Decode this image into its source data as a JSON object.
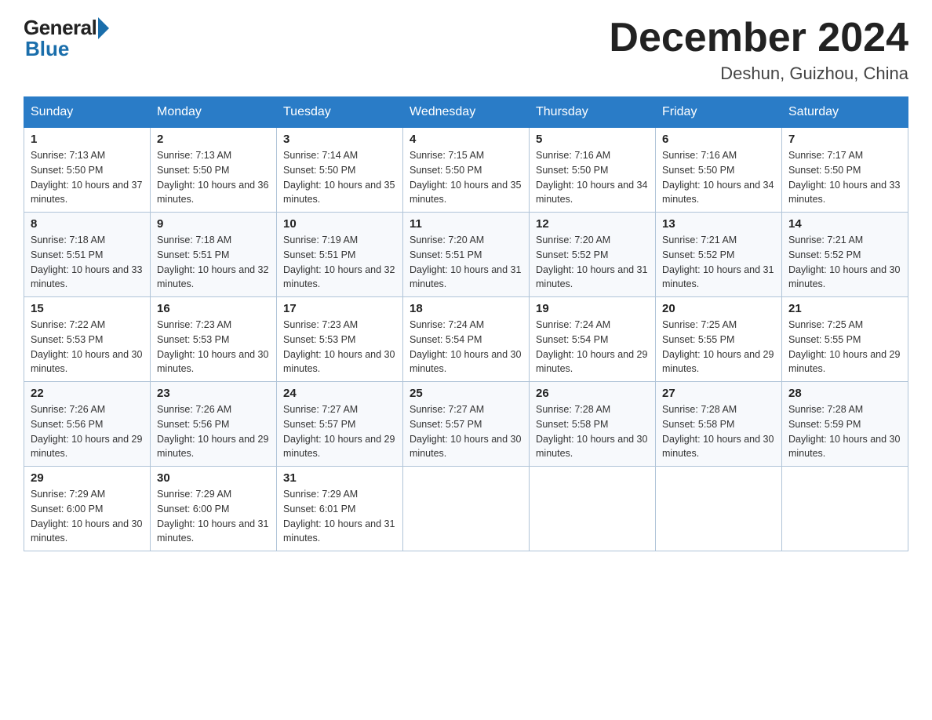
{
  "header": {
    "logo_text": "General",
    "logo_blue": "Blue",
    "month_title": "December 2024",
    "subtitle": "Deshun, Guizhou, China"
  },
  "days_of_week": [
    "Sunday",
    "Monday",
    "Tuesday",
    "Wednesday",
    "Thursday",
    "Friday",
    "Saturday"
  ],
  "weeks": [
    [
      {
        "day": "1",
        "sunrise": "7:13 AM",
        "sunset": "5:50 PM",
        "daylight": "10 hours and 37 minutes."
      },
      {
        "day": "2",
        "sunrise": "7:13 AM",
        "sunset": "5:50 PM",
        "daylight": "10 hours and 36 minutes."
      },
      {
        "day": "3",
        "sunrise": "7:14 AM",
        "sunset": "5:50 PM",
        "daylight": "10 hours and 35 minutes."
      },
      {
        "day": "4",
        "sunrise": "7:15 AM",
        "sunset": "5:50 PM",
        "daylight": "10 hours and 35 minutes."
      },
      {
        "day": "5",
        "sunrise": "7:16 AM",
        "sunset": "5:50 PM",
        "daylight": "10 hours and 34 minutes."
      },
      {
        "day": "6",
        "sunrise": "7:16 AM",
        "sunset": "5:50 PM",
        "daylight": "10 hours and 34 minutes."
      },
      {
        "day": "7",
        "sunrise": "7:17 AM",
        "sunset": "5:50 PM",
        "daylight": "10 hours and 33 minutes."
      }
    ],
    [
      {
        "day": "8",
        "sunrise": "7:18 AM",
        "sunset": "5:51 PM",
        "daylight": "10 hours and 33 minutes."
      },
      {
        "day": "9",
        "sunrise": "7:18 AM",
        "sunset": "5:51 PM",
        "daylight": "10 hours and 32 minutes."
      },
      {
        "day": "10",
        "sunrise": "7:19 AM",
        "sunset": "5:51 PM",
        "daylight": "10 hours and 32 minutes."
      },
      {
        "day": "11",
        "sunrise": "7:20 AM",
        "sunset": "5:51 PM",
        "daylight": "10 hours and 31 minutes."
      },
      {
        "day": "12",
        "sunrise": "7:20 AM",
        "sunset": "5:52 PM",
        "daylight": "10 hours and 31 minutes."
      },
      {
        "day": "13",
        "sunrise": "7:21 AM",
        "sunset": "5:52 PM",
        "daylight": "10 hours and 31 minutes."
      },
      {
        "day": "14",
        "sunrise": "7:21 AM",
        "sunset": "5:52 PM",
        "daylight": "10 hours and 30 minutes."
      }
    ],
    [
      {
        "day": "15",
        "sunrise": "7:22 AM",
        "sunset": "5:53 PM",
        "daylight": "10 hours and 30 minutes."
      },
      {
        "day": "16",
        "sunrise": "7:23 AM",
        "sunset": "5:53 PM",
        "daylight": "10 hours and 30 minutes."
      },
      {
        "day": "17",
        "sunrise": "7:23 AM",
        "sunset": "5:53 PM",
        "daylight": "10 hours and 30 minutes."
      },
      {
        "day": "18",
        "sunrise": "7:24 AM",
        "sunset": "5:54 PM",
        "daylight": "10 hours and 30 minutes."
      },
      {
        "day": "19",
        "sunrise": "7:24 AM",
        "sunset": "5:54 PM",
        "daylight": "10 hours and 29 minutes."
      },
      {
        "day": "20",
        "sunrise": "7:25 AM",
        "sunset": "5:55 PM",
        "daylight": "10 hours and 29 minutes."
      },
      {
        "day": "21",
        "sunrise": "7:25 AM",
        "sunset": "5:55 PM",
        "daylight": "10 hours and 29 minutes."
      }
    ],
    [
      {
        "day": "22",
        "sunrise": "7:26 AM",
        "sunset": "5:56 PM",
        "daylight": "10 hours and 29 minutes."
      },
      {
        "day": "23",
        "sunrise": "7:26 AM",
        "sunset": "5:56 PM",
        "daylight": "10 hours and 29 minutes."
      },
      {
        "day": "24",
        "sunrise": "7:27 AM",
        "sunset": "5:57 PM",
        "daylight": "10 hours and 29 minutes."
      },
      {
        "day": "25",
        "sunrise": "7:27 AM",
        "sunset": "5:57 PM",
        "daylight": "10 hours and 30 minutes."
      },
      {
        "day": "26",
        "sunrise": "7:28 AM",
        "sunset": "5:58 PM",
        "daylight": "10 hours and 30 minutes."
      },
      {
        "day": "27",
        "sunrise": "7:28 AM",
        "sunset": "5:58 PM",
        "daylight": "10 hours and 30 minutes."
      },
      {
        "day": "28",
        "sunrise": "7:28 AM",
        "sunset": "5:59 PM",
        "daylight": "10 hours and 30 minutes."
      }
    ],
    [
      {
        "day": "29",
        "sunrise": "7:29 AM",
        "sunset": "6:00 PM",
        "daylight": "10 hours and 30 minutes."
      },
      {
        "day": "30",
        "sunrise": "7:29 AM",
        "sunset": "6:00 PM",
        "daylight": "10 hours and 31 minutes."
      },
      {
        "day": "31",
        "sunrise": "7:29 AM",
        "sunset": "6:01 PM",
        "daylight": "10 hours and 31 minutes."
      },
      null,
      null,
      null,
      null
    ]
  ],
  "labels": {
    "sunrise_prefix": "Sunrise: ",
    "sunset_prefix": "Sunset: ",
    "daylight_prefix": "Daylight: "
  }
}
